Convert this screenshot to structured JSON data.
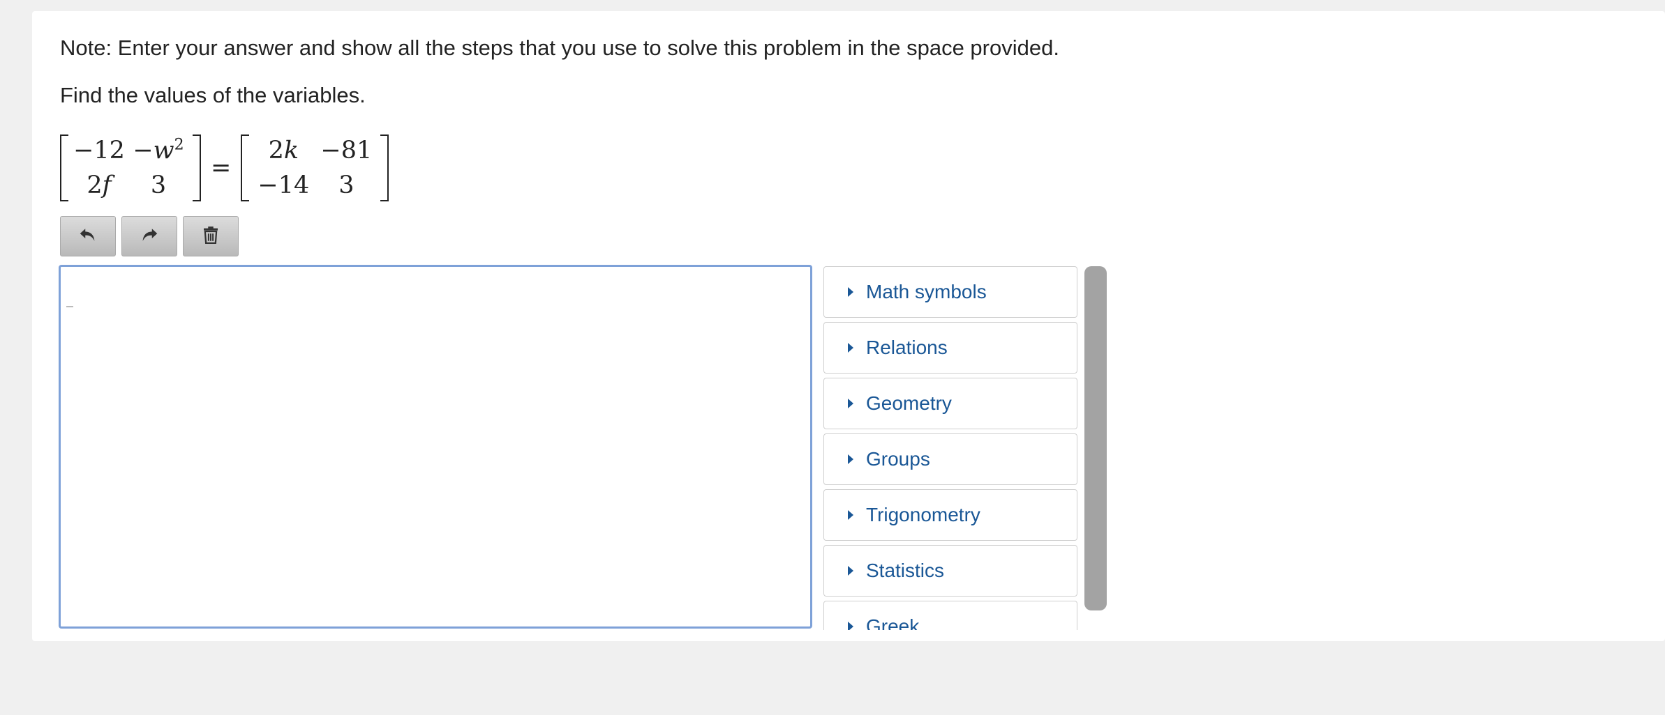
{
  "question": {
    "note": "Note: Enter your answer and show all the steps that you use to solve this problem in the space provided.",
    "prompt": "Find the values of the variables."
  },
  "equation": {
    "left_matrix": {
      "r1c1": "−12",
      "r1c2_prefix": "−",
      "r1c2_var": "w",
      "r1c2_exp": "2",
      "r2c1_coef": "2",
      "r2c1_var": "f",
      "r2c2": "3"
    },
    "equals": "=",
    "right_matrix": {
      "r1c1_coef": "2",
      "r1c1_var": "k",
      "r1c2": "−81",
      "r2c1": "−14",
      "r2c2": "3"
    }
  },
  "toolbar": {
    "undo_icon": "undo-icon",
    "redo_icon": "redo-icon",
    "delete_icon": "trash-icon"
  },
  "editor": {
    "value": ""
  },
  "palette": {
    "items": [
      {
        "label": "Math symbols"
      },
      {
        "label": "Relations"
      },
      {
        "label": "Geometry"
      },
      {
        "label": "Groups"
      },
      {
        "label": "Trigonometry"
      },
      {
        "label": "Statistics"
      },
      {
        "label": "Greek"
      }
    ]
  },
  "colors": {
    "link": "#1a5796",
    "editor_border": "#7ea1d8",
    "scrollbar": "#a3a3a3",
    "page_bg": "#f0f0f0"
  }
}
